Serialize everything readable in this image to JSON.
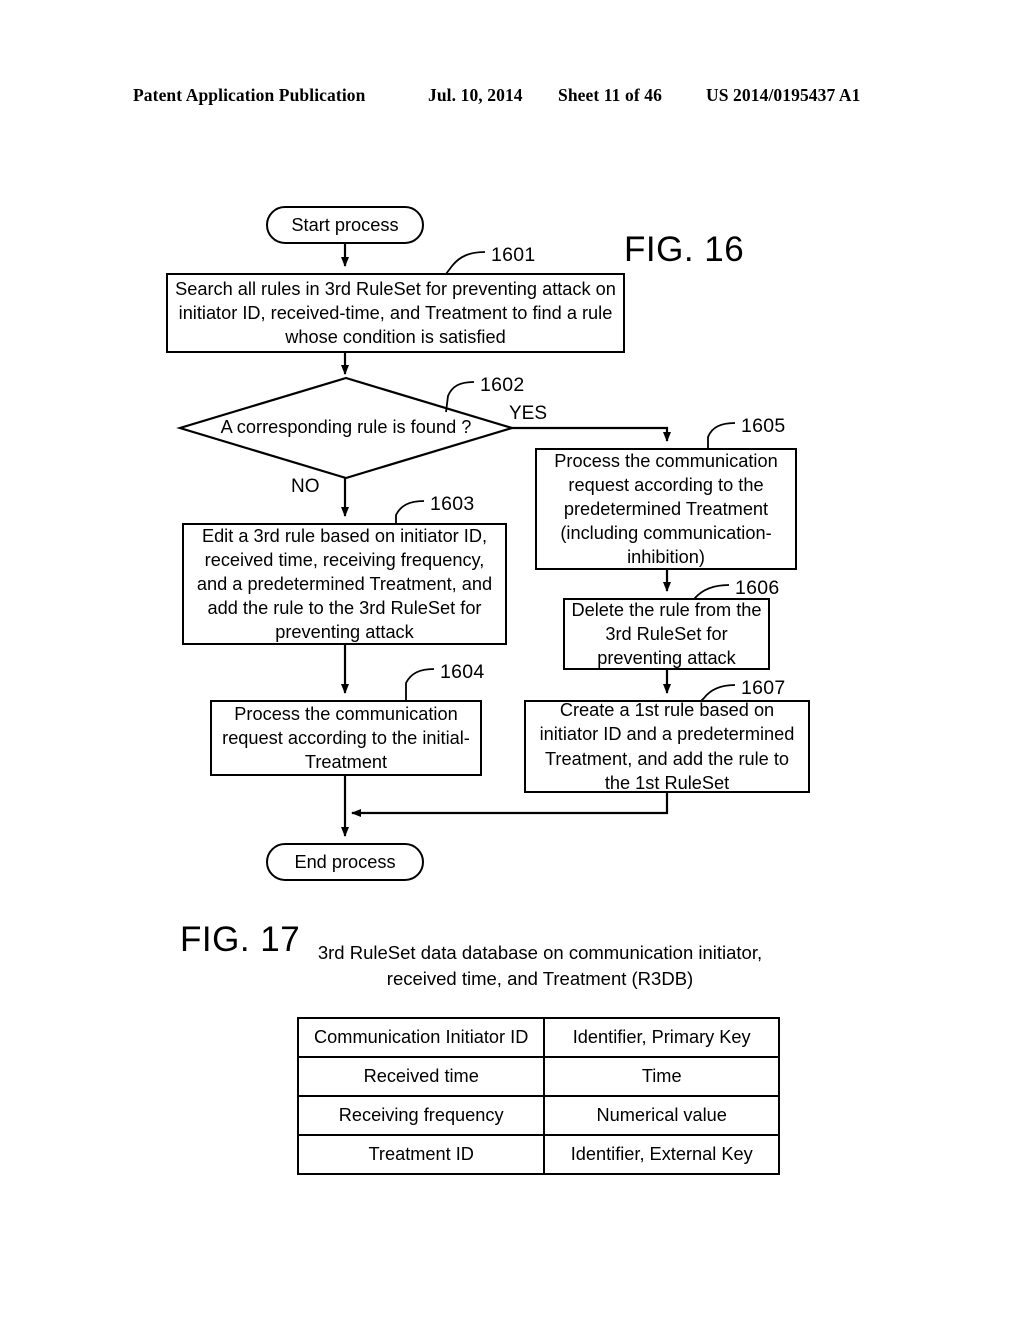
{
  "header": {
    "publication": "Patent Application Publication",
    "date": "Jul. 10, 2014",
    "sheet": "Sheet 11 of 46",
    "patent_number": "US 2014/0195437 A1"
  },
  "figures": {
    "fig16": {
      "label": "FIG. 16",
      "nodes": {
        "start": "Start process",
        "n1601": "Search all rules in 3rd RuleSet for preventing attack on initiator ID, received-time, and Treatment to find a rule whose condition is satisfied",
        "n1602": "A corresponding rule is found ?",
        "n1603": "Edit a 3rd rule based on initiator ID, received time,  receiving frequency, and a predetermined Treatment, and add the rule to the 3rd RuleSet for preventing attack",
        "n1604": "Process the communication request according to the initial-Treatment",
        "n1605": "Process the communication request according to the predetermined Treatment (including communication-inhibition)",
        "n1606": "Delete the rule from the 3rd RuleSet for preventing attack",
        "n1607": "Create a 1st rule based on initiator ID and a predetermined Treatment, and add the rule to the 1st RuleSet",
        "end": "End process"
      },
      "branches": {
        "yes": "YES",
        "no": "NO"
      },
      "reference_numerals": {
        "n1601": "1601",
        "n1602": "1602",
        "n1603": "1603",
        "n1604": "1604",
        "n1605": "1605",
        "n1606": "1606",
        "n1607": "1607"
      }
    },
    "fig17": {
      "label": "FIG. 17",
      "caption": "3rd RuleSet data database on communication initiator, received time, and Treatment (R3DB)",
      "table": {
        "rows": [
          {
            "field": "Communication Initiator ID",
            "type": "Identifier, Primary Key"
          },
          {
            "field": "Received time",
            "type": "Time"
          },
          {
            "field": "Receiving frequency",
            "type": "Numerical value"
          },
          {
            "field": "Treatment ID",
            "type": "Identifier, External Key"
          }
        ]
      }
    }
  },
  "colors": {
    "ink": "#000000",
    "paper": "#ffffff"
  }
}
